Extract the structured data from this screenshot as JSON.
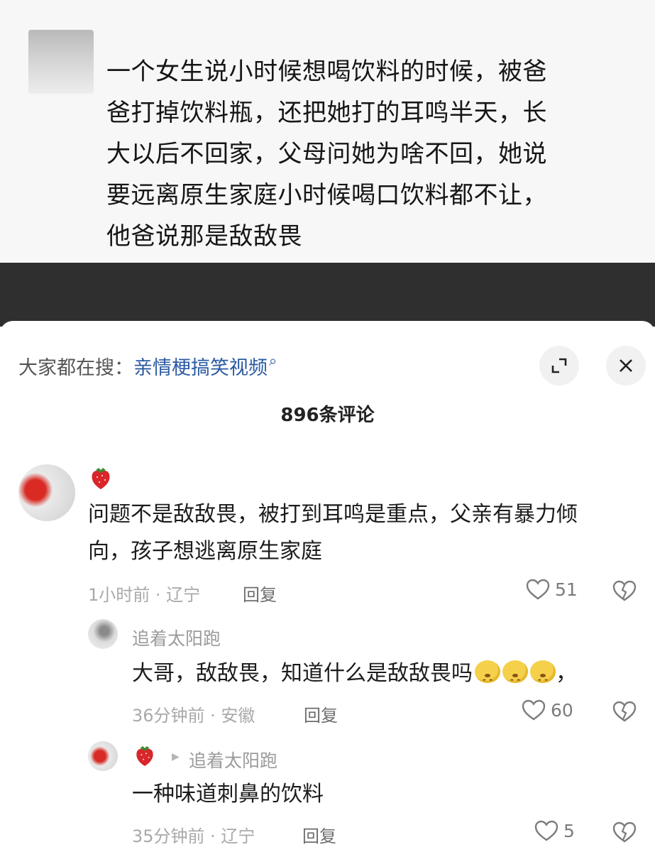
{
  "post": {
    "lines": [
      "一个女生说小时候想喝饮料的时候，被爸",
      "爸打掉饮料瓶，还把她打的耳鸣半天，长",
      "大以后不回家，父母问她为啥不回，她说",
      "要远离原生家庭小时候喝口饮料都不让，",
      "他爸说那是敌敌畏"
    ]
  },
  "sheet": {
    "search_prefix": "大家都在搜：",
    "search_keyword": "亲情梗搞笑视频",
    "comment_count": "896条评论"
  },
  "comments": [
    {
      "text_lines": [
        "问题不是敌敌畏，被打到耳鸣是重点，父亲有暴力倾",
        "向，孩子想逃离原生家庭"
      ],
      "time_location": "1小时前 · 辽宁",
      "reply_label": "回复",
      "likes": "51"
    },
    {
      "username": "追着太阳跑",
      "text": "大哥，敌敌畏，知道什么是敌敌畏吗",
      "trailing": "，",
      "time_location": "36分钟前 · 安徽",
      "reply_label": "回复",
      "likes": "60"
    },
    {
      "reply_to": "追着太阳跑",
      "text": "一种味道刺鼻的饮料",
      "time_location": "35分钟前 · 辽宁",
      "reply_label": "回复",
      "likes": "5"
    }
  ],
  "icons": {
    "expand": "expand-icon",
    "close": "close-icon",
    "like": "heart-icon",
    "dislike": "broken-heart-icon",
    "badge": "strawberry-icon",
    "emoji": "frowning-face-emoji"
  },
  "colors": {
    "keyword": "#2b5aa3",
    "band": "#2f2f2f",
    "meta": "#a9a9a9"
  }
}
